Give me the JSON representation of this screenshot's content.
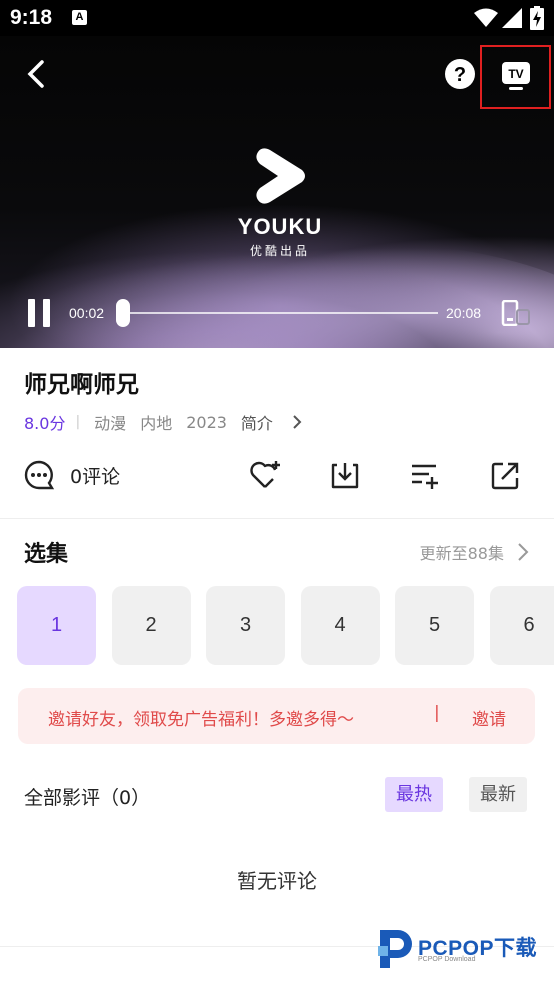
{
  "status_bar": {
    "time": "9:18",
    "notif_icon_letter": "A"
  },
  "player": {
    "current_time": "00:02",
    "total_time": "20:08",
    "progress": 0.0017,
    "logo_text": "YOUKU",
    "logo_sub": "优酷出品"
  },
  "show": {
    "title": "师兄啊师兄",
    "score": "8.0分",
    "separator": "|",
    "genre": "动漫",
    "region": "内地",
    "year": "2023",
    "intro_label": "简介"
  },
  "actions": {
    "comment_count": "0评论"
  },
  "episodes": {
    "section_title": "选集",
    "update_label": "更新至88集",
    "items": [
      "1",
      "2",
      "3",
      "4",
      "5",
      "6"
    ]
  },
  "invite": {
    "message": "邀请好友，领取免广告福利！多邀多得～",
    "separator": "|",
    "button": "邀请"
  },
  "reviews": {
    "title": "全部影评（0）",
    "sort_hot": "最热",
    "sort_new": "最新",
    "empty_text": "暂无评论"
  },
  "watermark": {
    "text": "PCPOP下载",
    "sub": "PCPOP Download"
  },
  "colors": {
    "accent": "#6a36e0",
    "invite_text": "#e04a4a",
    "highlight_box": "#e02020"
  }
}
